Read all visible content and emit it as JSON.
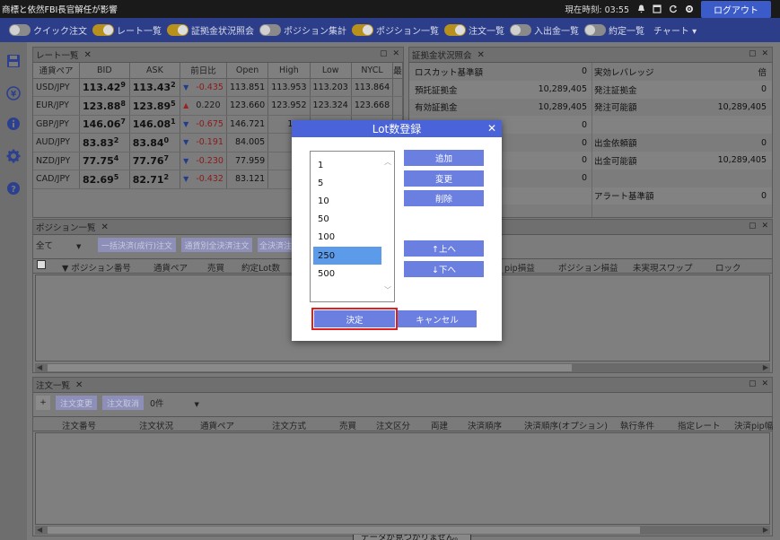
{
  "topbar": {
    "news": "商標と依然FBI長官解任が影響",
    "clock_label": "現在時刻:",
    "clock_time": "03:55",
    "logout": "ログアウト"
  },
  "nav": {
    "items": [
      {
        "label": "クイック注文",
        "on": false
      },
      {
        "label": "レート一覧",
        "on": true
      },
      {
        "label": "証拠金状況照会",
        "on": true
      },
      {
        "label": "ポジション集計",
        "on": false
      },
      {
        "label": "ポジション一覧",
        "on": true
      },
      {
        "label": "注文一覧",
        "on": true
      },
      {
        "label": "入出金一覧",
        "on": false
      },
      {
        "label": "約定一覧",
        "on": false
      }
    ],
    "chart": "チャート ▾"
  },
  "rate_panel": {
    "title": "レート一覧",
    "columns": [
      "通貨ペア",
      "BID",
      "ASK",
      "前日比",
      "Open",
      "High",
      "Low",
      "NYCL",
      "最"
    ],
    "rows": [
      {
        "pair": "USD/JPY",
        "bid_main": "113.42",
        "bid_pip": "9",
        "ask_main": "113.43",
        "ask_pip": "2",
        "dir": "down",
        "change": "-0.435",
        "open": "113.851",
        "high": "113.953",
        "low": "113.203",
        "nycl": "113.864"
      },
      {
        "pair": "EUR/JPY",
        "bid_main": "123.88",
        "bid_pip": "8",
        "ask_main": "123.89",
        "ask_pip": "5",
        "dir": "up",
        "change": "0.220",
        "open": "123.660",
        "high": "123.952",
        "low": "123.324",
        "nycl": "123.668"
      },
      {
        "pair": "GBP/JPY",
        "bid_main": "146.06",
        "bid_pip": "7",
        "ask_main": "146.08",
        "ask_pip": "1",
        "dir": "down",
        "change": "-0.675",
        "open": "146.721",
        "high": "146.",
        "low": "",
        "nycl": ""
      },
      {
        "pair": "AUD/JPY",
        "bid_main": "83.83",
        "bid_pip": "2",
        "ask_main": "83.84",
        "ask_pip": "0",
        "dir": "down",
        "change": "-0.191",
        "open": "84.005",
        "high": "84.",
        "low": "",
        "nycl": ""
      },
      {
        "pair": "NZD/JPY",
        "bid_main": "77.75",
        "bid_pip": "4",
        "ask_main": "77.76",
        "ask_pip": "7",
        "dir": "down",
        "change": "-0.230",
        "open": "77.959",
        "high": "77.",
        "low": "",
        "nycl": ""
      },
      {
        "pair": "CAD/JPY",
        "bid_main": "82.69",
        "bid_pip": "5",
        "ask_main": "82.71",
        "ask_pip": "2",
        "dir": "down",
        "change": "-0.432",
        "open": "83.121",
        "high": "83.",
        "low": "",
        "nycl": ""
      }
    ]
  },
  "margin_panel": {
    "title": "証拠金状況照会",
    "left": [
      {
        "label": "ロスカット基準額",
        "value": "0"
      },
      {
        "label": "預託証拠金",
        "value": "10,289,405"
      },
      {
        "label": "有効証拠金",
        "value": "10,289,405"
      },
      {
        "label": "",
        "value": "0"
      },
      {
        "label": "",
        "value": "0"
      },
      {
        "label": "",
        "value": "0"
      },
      {
        "label": "",
        "value": "0"
      },
      {
        "label": "",
        "value": ""
      }
    ],
    "right": [
      {
        "label": "実効レバレッジ",
        "value": "倍"
      },
      {
        "label": "発注証拠金",
        "value": "0"
      },
      {
        "label": "発注可能額",
        "value": "10,289,405"
      },
      {
        "label": "",
        "value": ""
      },
      {
        "label": "出金依頼額",
        "value": "0"
      },
      {
        "label": "出金可能額",
        "value": "10,289,405"
      },
      {
        "label": "",
        "value": ""
      },
      {
        "label": "アラート基準額",
        "value": "0"
      }
    ]
  },
  "position_panel": {
    "title": "ポジション一覧",
    "filter": "全て",
    "buttons": [
      "一括決済(成行)注文",
      "通貨別全決済注文",
      "全決済注"
    ],
    "columns": [
      "▼ ポジション番号",
      "通貨ペア",
      "売買",
      "約定Lot数",
      "pip損益",
      "ポジション損益",
      "未実現スワップ",
      "ロック"
    ]
  },
  "order_panel": {
    "title": "注文一覧",
    "buttons": [
      "注文変更",
      "注文取消"
    ],
    "count": "0件",
    "columns": [
      "注文番号",
      "注文状況",
      "通貨ペア",
      "注文方式",
      "売買",
      "注文区分",
      "両建",
      "決済順序",
      "決済順序(オプション)",
      "執行条件",
      "指定レート",
      "決済pip幅"
    ],
    "nodata": "データが見つかりません。"
  },
  "modal": {
    "title": "Lot数登録",
    "lots": [
      "1",
      "5",
      "10",
      "50",
      "100",
      "250",
      "500"
    ],
    "selected_index": 5,
    "add": "追加",
    "change": "変更",
    "delete": "削除",
    "up": "↑上へ",
    "down": "↓下へ",
    "ok": "決定",
    "cancel": "キャンセル"
  }
}
